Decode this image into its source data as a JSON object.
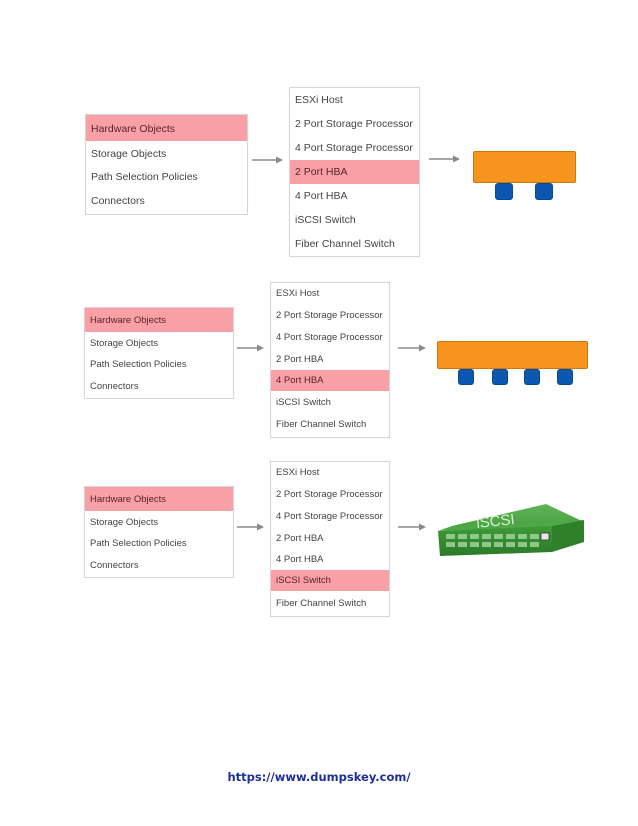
{
  "diagram": {
    "colors": {
      "selected_row": "#f8a0a6",
      "hba_body": "#f7941d",
      "hba_port": "#0c58b0",
      "switch_green": "#3f9a3a",
      "arrow": "#8a8a8a"
    },
    "sections": [
      {
        "category_list": [
          "Hardware Objects",
          "Storage Objects",
          "Path Selection Policies",
          "Connectors"
        ],
        "category_selected": 0,
        "object_list": [
          "ESXi Host",
          "2 Port Storage Processor",
          "4 Port Storage Processor",
          "2 Port HBA",
          "4 Port HBA",
          "iSCSI Switch",
          "Fiber Channel Switch"
        ],
        "object_selected": 3,
        "result_icon": "2-port-hba-icon",
        "port_count": 2
      },
      {
        "category_list": [
          "Hardware Objects",
          "Storage Objects",
          "Path Selection Policies",
          "Connectors"
        ],
        "category_selected": 0,
        "object_list": [
          "ESXi Host",
          "2 Port Storage Processor",
          "4 Port Storage Processor",
          "2 Port HBA",
          "4 Port HBA",
          "iSCSI Switch",
          "Fiber Channel Switch"
        ],
        "object_selected": 4,
        "result_icon": "4-port-hba-icon",
        "port_count": 4
      },
      {
        "category_list": [
          "Hardware Objects",
          "Storage Objects",
          "Path Selection Policies",
          "Connectors"
        ],
        "category_selected": 0,
        "object_list": [
          "ESXi Host",
          "2 Port Storage Processor",
          "4 Port Storage Processor",
          "2 Port HBA",
          "4 Port HBA",
          "iSCSI Switch",
          "Fiber Channel Switch"
        ],
        "object_selected": 5,
        "result_icon": "iscsi-switch-icon",
        "switch_label": "iSCSI"
      }
    ]
  },
  "footer": {
    "url": "https://www.dumpskey.com/"
  }
}
